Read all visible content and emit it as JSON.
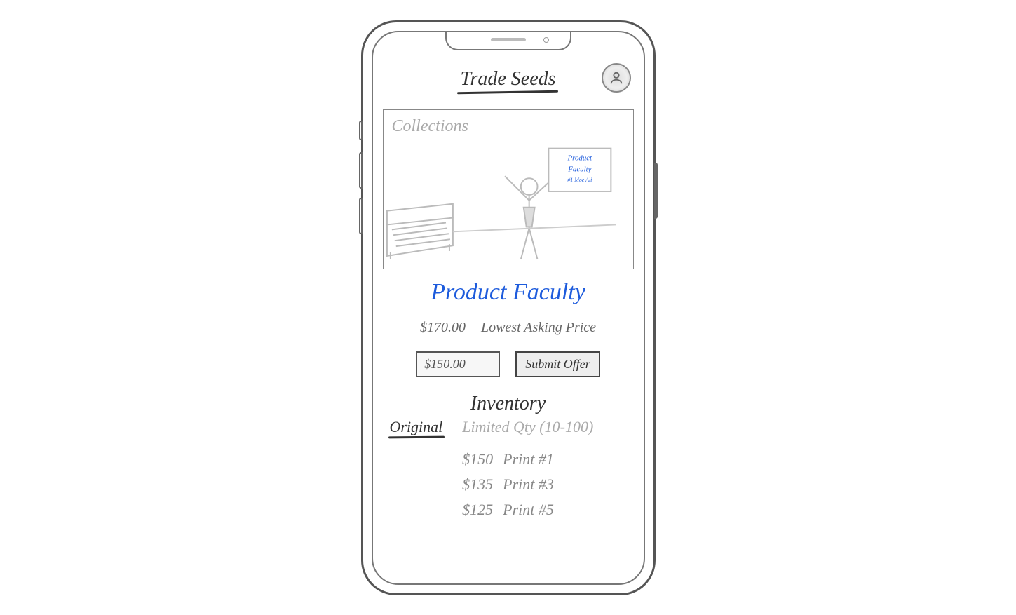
{
  "header": {
    "title": "Trade Seeds",
    "avatar_icon": "user-icon"
  },
  "hero": {
    "label": "Collections",
    "poster_line1": "Product",
    "poster_line2": "Faculty",
    "poster_line3": "#1 Moe Ali"
  },
  "product": {
    "title": "Product  Faculty",
    "price": "$170.00",
    "price_label": "Lowest Asking Price"
  },
  "offer": {
    "input_value": "$150.00",
    "submit_label": "Submit Offer"
  },
  "inventory": {
    "title": "Inventory",
    "tabs": [
      {
        "label": "Original",
        "active": true
      },
      {
        "label": "Limited Qty (10-100)",
        "active": false
      }
    ],
    "prints": [
      {
        "price": "$150",
        "label": "Print #1"
      },
      {
        "price": "$135",
        "label": "Print #3"
      },
      {
        "price": "$125",
        "label": "Print #5"
      }
    ]
  }
}
